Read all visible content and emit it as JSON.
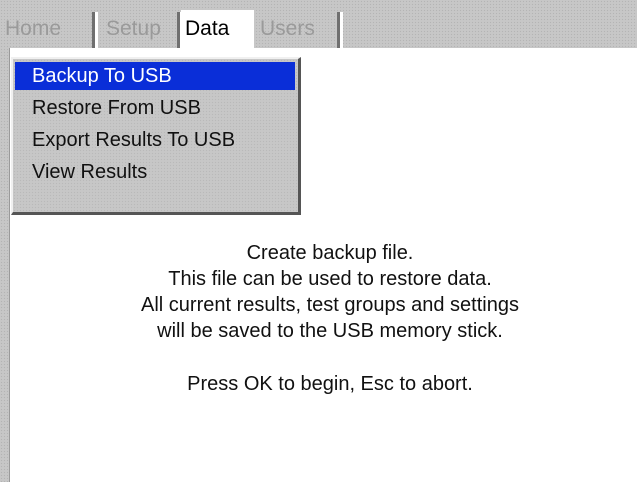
{
  "tabs": [
    {
      "label": "Home",
      "active": false
    },
    {
      "label": "Setup",
      "active": false
    },
    {
      "label": "Data",
      "active": true
    },
    {
      "label": "Users",
      "active": false
    }
  ],
  "menu": {
    "items": [
      {
        "label": "Backup To USB",
        "selected": true
      },
      {
        "label": "Restore From USB",
        "selected": false
      },
      {
        "label": "Export Results To USB",
        "selected": false
      },
      {
        "label": "View Results",
        "selected": false
      }
    ]
  },
  "message": {
    "lines": [
      "Create backup file.",
      "This file can be used to restore data.",
      "All current results, test groups and settings",
      "will be saved to the USB memory stick."
    ],
    "prompt": "Press OK to begin, Esc to abort."
  },
  "colors": {
    "selection": "#0a2ed8",
    "chrome": "#c7c7c7"
  }
}
